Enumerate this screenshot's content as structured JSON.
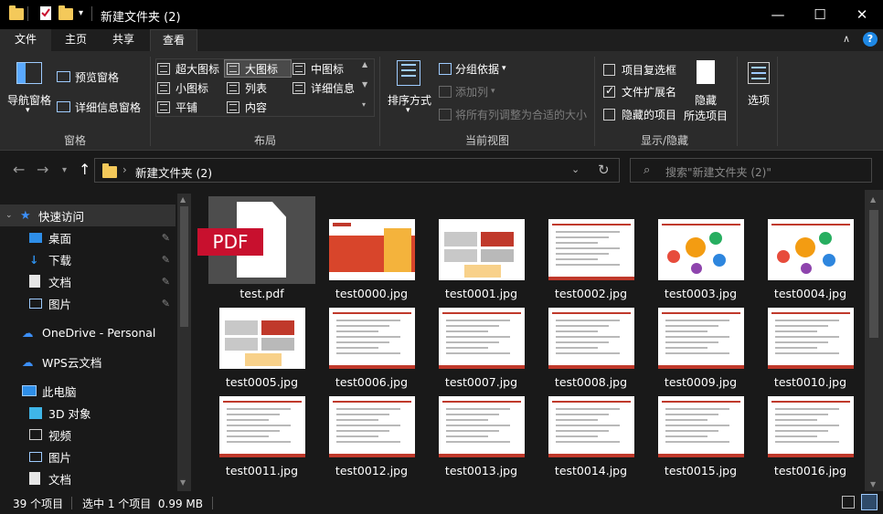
{
  "window": {
    "title": "新建文件夹 (2)",
    "minimize": "—",
    "maximize": "☐",
    "close": "✕"
  },
  "tabs": [
    "文件",
    "主页",
    "共享",
    "查看"
  ],
  "ribbon": {
    "panes": {
      "nav_pane": "导航窗格",
      "preview_pane": "预览窗格",
      "details_pane": "详细信息窗格",
      "group": "窗格"
    },
    "layout": {
      "items": [
        "超大图标",
        "大图标",
        "中图标",
        "小图标",
        "列表",
        "详细信息",
        "平铺",
        "内容"
      ],
      "selected": "大图标",
      "group": "布局"
    },
    "current_view": {
      "sort_by": "排序方式",
      "group_by": "分组依据",
      "add_columns": "添加列",
      "fit_columns": "将所有列调整为合适的大小",
      "group": "当前视图"
    },
    "show_hide": {
      "item_checkboxes": "项目复选框",
      "file_extensions": "文件扩展名",
      "hidden_items": "隐藏的项目",
      "hide_selected_1": "隐藏",
      "hide_selected_2": "所选项目",
      "group": "显示/隐藏",
      "checked": {
        "item_checkboxes": false,
        "file_extensions": true,
        "hidden_items": false
      }
    },
    "options": "选项"
  },
  "address": {
    "path": "新建文件夹 (2)",
    "search_placeholder": "搜索\"新建文件夹 (2)\""
  },
  "sidebar": {
    "quick_access": "快速访问",
    "items": [
      "桌面",
      "下载",
      "文档",
      "图片"
    ],
    "onedrive": "OneDrive - Personal",
    "wps": "WPS云文档",
    "this_pc": "此电脑",
    "pc_items": [
      "3D 对象",
      "视频",
      "图片",
      "文档"
    ]
  },
  "files": [
    {
      "name": "test.pdf",
      "kind": "pdf",
      "selected": true
    },
    {
      "name": "test0000.jpg",
      "kind": "cover"
    },
    {
      "name": "test0001.jpg",
      "kind": "boxes"
    },
    {
      "name": "test0002.jpg",
      "kind": "text"
    },
    {
      "name": "test0003.jpg",
      "kind": "diagram"
    },
    {
      "name": "test0004.jpg",
      "kind": "diagram"
    },
    {
      "name": "test0005.jpg",
      "kind": "boxes"
    },
    {
      "name": "test0006.jpg",
      "kind": "text"
    },
    {
      "name": "test0007.jpg",
      "kind": "text"
    },
    {
      "name": "test0008.jpg",
      "kind": "text"
    },
    {
      "name": "test0009.jpg",
      "kind": "text"
    },
    {
      "name": "test0010.jpg",
      "kind": "text"
    },
    {
      "name": "test0011.jpg",
      "kind": "text"
    },
    {
      "name": "test0012.jpg",
      "kind": "text"
    },
    {
      "name": "test0013.jpg",
      "kind": "text"
    },
    {
      "name": "test0014.jpg",
      "kind": "text"
    },
    {
      "name": "test0015.jpg",
      "kind": "text"
    },
    {
      "name": "test0016.jpg",
      "kind": "text"
    }
  ],
  "pdf_label": "PDF",
  "status": {
    "count": "39 个项目",
    "selection": "选中 1 个项目  0.99 MB"
  },
  "colors": {
    "accent_red": "#c8102e",
    "folder": "#f4c95a",
    "selection": "#4d4d4d"
  }
}
